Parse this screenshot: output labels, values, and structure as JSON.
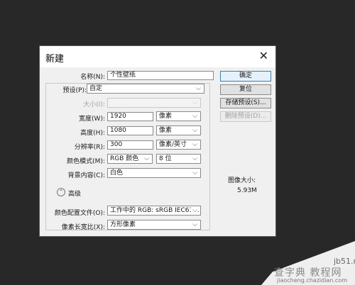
{
  "dialog": {
    "title": "新建",
    "fields": {
      "name_label": "名称(N):",
      "name_value": "个性壁纸",
      "preset_label": "预设(P):",
      "preset_value": "自定",
      "size_label": "大小(I):",
      "size_value": "",
      "width_label": "宽度(W):",
      "width_value": "1920",
      "width_unit": "像素",
      "height_label": "高度(H):",
      "height_value": "1080",
      "height_unit": "像素",
      "resolution_label": "分辨率(R):",
      "resolution_value": "300",
      "resolution_unit": "像素/英寸",
      "color_mode_label": "颜色模式(M):",
      "color_mode_value": "RGB 颜色",
      "bit_depth_value": "8 位",
      "background_label": "背景内容(C):",
      "background_value": "白色",
      "advanced_label": "高级",
      "color_profile_label": "颜色配置文件(O):",
      "color_profile_value": "工作中的 RGB: sRGB IEC61...",
      "pixel_aspect_label": "像素长宽比(X):",
      "pixel_aspect_value": "方形像素"
    },
    "buttons": {
      "ok": "确定",
      "reset": "复位",
      "save_preset": "存储预设(S)...",
      "delete_preset": "删除预设(D)..."
    },
    "image_size": {
      "label": "图像大小:",
      "value": "5.93M"
    },
    "icons": {
      "close": "close-icon",
      "chevron": "chevron-down-icon",
      "advanced": "collapse-toggle-icon"
    }
  },
  "watermark": {
    "top_text": "jb51.net",
    "main_text": "查字典 教程网",
    "url_text": "jiaocheng.chazidian.com"
  },
  "colors": {
    "desktop": "#282828",
    "dialog_bg": "#f0f0f0",
    "primary_button_border": "#3c7fb1"
  }
}
